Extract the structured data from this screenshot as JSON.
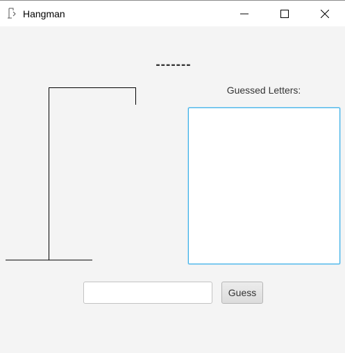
{
  "window": {
    "title": "Hangman",
    "icon": "java-app-icon",
    "controls": [
      "minimize-icon",
      "maximize-icon",
      "close-icon"
    ]
  },
  "game": {
    "word_display": "-------",
    "guessed_label": "Guessed Letters:",
    "guessed_letters": "",
    "guess_input_value": "",
    "guess_button_label": "Guess"
  },
  "colors": {
    "background": "#f4f4f4",
    "focus_border": "#3eb0e6"
  }
}
